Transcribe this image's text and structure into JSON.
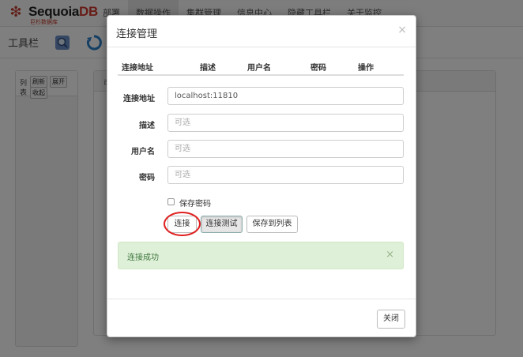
{
  "header": {
    "brand_main": "Sequoia",
    "brand_suffix": "DB",
    "brand_sub": "巨杉数据库",
    "nav": [
      "部署",
      "数据操作",
      "集群管理",
      "信息中心",
      "隐藏工具栏",
      "关于监控"
    ]
  },
  "toolbar": {
    "label": "工具栏"
  },
  "left_panel": {
    "title_line1": "列",
    "title_line2": "表",
    "refresh": "刷新",
    "expand": "展开",
    "collapse": "收起"
  },
  "right_panel": {
    "header_text": "可"
  },
  "modal": {
    "title": "连接管理",
    "close_icon": "×",
    "list_columns": [
      "连接地址",
      "描述",
      "用户名",
      "密码",
      "操作"
    ],
    "fields": {
      "address": {
        "label": "连接地址",
        "value": "localhost:11810"
      },
      "description": {
        "label": "描述",
        "placeholder": "可选"
      },
      "username": {
        "label": "用户名",
        "placeholder": "可选"
      },
      "password": {
        "label": "密码",
        "placeholder": "可选"
      }
    },
    "save_password_label": "保存密码",
    "buttons": {
      "connect": "连接",
      "test": "连接测试",
      "save_list": "保存到列表"
    },
    "alert": {
      "text": "连接成功",
      "close": "×"
    },
    "footer_close": "关闭"
  },
  "colors": {
    "alert_bg": "#dff0d8",
    "alert_text": "#3c763d",
    "highlight_circle": "#e02020",
    "brand_red": "#d0392f"
  }
}
